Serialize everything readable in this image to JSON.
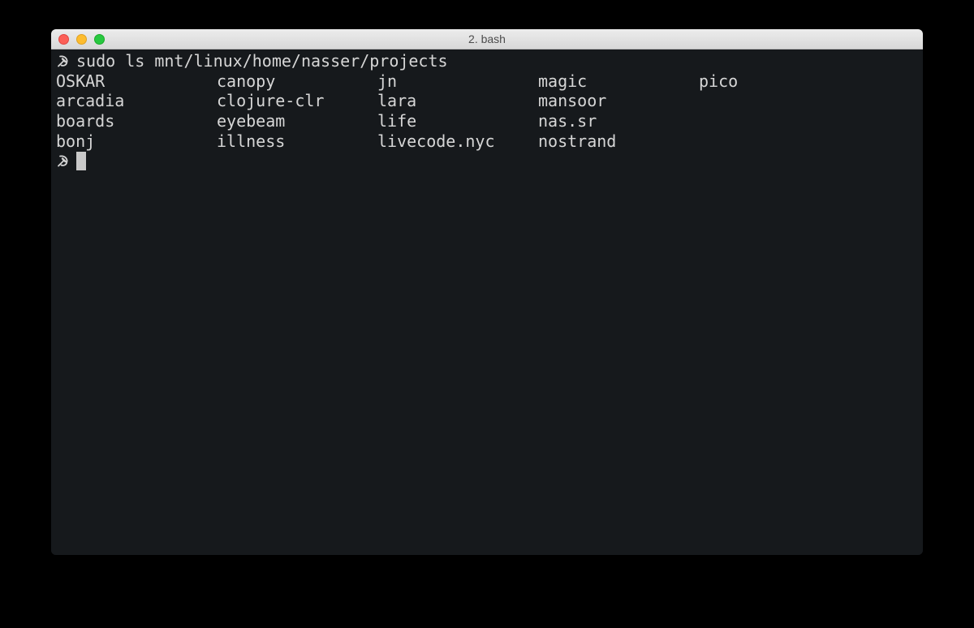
{
  "window": {
    "title": "2. bash"
  },
  "terminal": {
    "prompt_icon": "hammer-and-sickle-icon",
    "command": "sudo ls mnt/linux/home/nasser/projects",
    "ls_output": [
      "OSKAR",
      "canopy",
      "jn",
      "magic",
      "pico",
      "arcadia",
      "clojure-clr",
      "lara",
      "mansoor",
      "",
      "boards",
      "eyebeam",
      "life",
      "nas.sr",
      "",
      "bonj",
      "illness",
      "livecode.nyc",
      "nostrand",
      ""
    ]
  },
  "colors": {
    "terminal_background": "#16191c",
    "terminal_text": "#d6d6d6",
    "cursor": "#c9c9c9",
    "close": "#fc5f57",
    "minimize": "#fdbc2e",
    "zoom": "#28c840"
  }
}
